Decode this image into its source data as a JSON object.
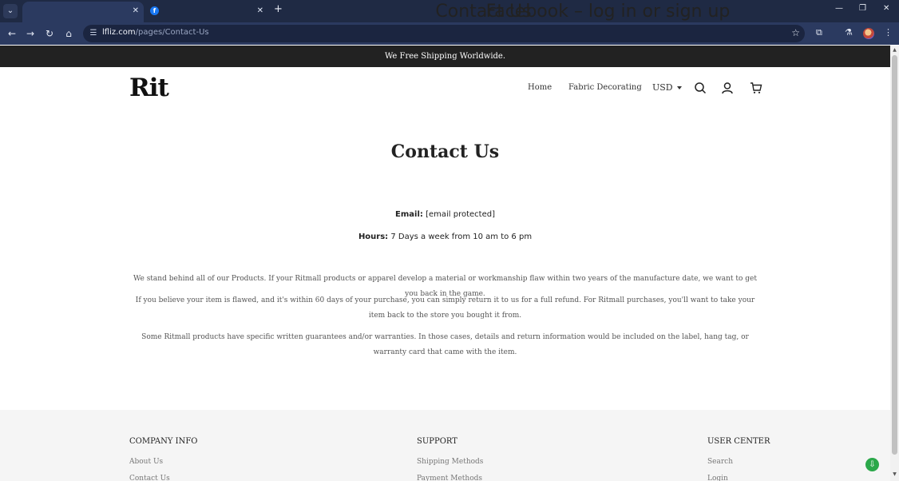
{
  "browser": {
    "tabs": [
      {
        "title": "Contact Us",
        "active": true
      },
      {
        "title": "Facebook – log in or sign up",
        "active": false
      }
    ],
    "url_host": "lfliz.com",
    "url_path": "/pages/Contact-Us"
  },
  "announcement": "We Free Shipping Worldwide.",
  "header": {
    "logo": "Rit",
    "nav": [
      "Home",
      "Fabric Decorating"
    ],
    "currency": "USD"
  },
  "main": {
    "title": "Contact Us",
    "email_label": "Email:",
    "email_value": "[email protected]",
    "hours_label": "Hours:",
    "hours_value": "7 Days a week from 10 am to 6 pm",
    "paragraphs": [
      "We stand behind all of our Products. If your Ritmall products or apparel develop a material or workmanship flaw within two years of the manufacture date, we want to get you back in the game.",
      "If you believe your item is flawed, and it's within 60 days of your purchase, you can simply return it to us for a full refund. For Ritmall purchases, you'll want to take your item back to the store you bought it from.",
      "Some Ritmall products have specific written guarantees and/or warranties. In those cases, details and return information would be included on the label, hang tag, or warranty card that came with the item."
    ]
  },
  "footer": {
    "columns": [
      {
        "heading": "COMPANY INFO",
        "links": [
          "About Us",
          "Contact Us"
        ]
      },
      {
        "heading": "SUPPORT",
        "links": [
          "Shipping Methods",
          "Payment Methods"
        ]
      },
      {
        "heading": "USER CENTER",
        "links": [
          "Search",
          "Login"
        ]
      }
    ]
  },
  "colors": {
    "tabbar": "#1f2a44",
    "toolbar": "#2b3a60",
    "announcement_bg": "#222222",
    "footer_bg": "#f5f5f5",
    "chat_green": "#2ba84a"
  }
}
